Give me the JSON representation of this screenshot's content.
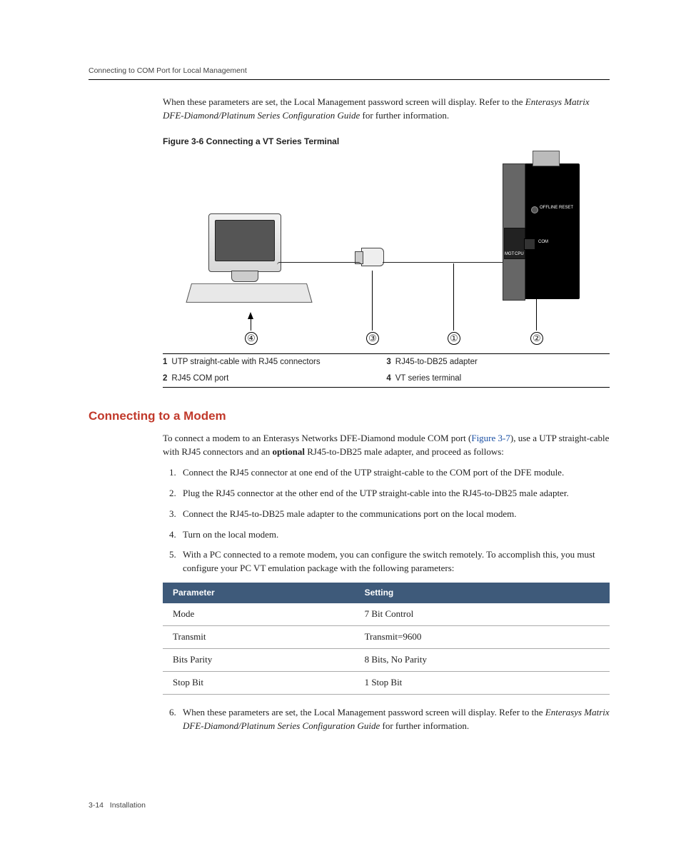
{
  "header": {
    "running": "Connecting to COM Port for Local Management"
  },
  "intro": {
    "line1": "When these parameters are set, the Local Management password screen will display. Refer to the ",
    "italic": "Enterasys Matrix DFE-Diamond/Platinum Series Configuration Guide",
    "line2": " for further information."
  },
  "figure": {
    "caption": "Figure 3-6    Connecting a VT Series Terminal",
    "markers": {
      "m1": "①",
      "m2": "②",
      "m3": "③",
      "m4": "④"
    },
    "module_labels": {
      "reset": "OFFLINE\nRESET",
      "com": "COM",
      "mgmt": "MGT",
      "cpu": "CPU"
    }
  },
  "legend": {
    "rows": [
      {
        "n": "1",
        "text": "UTP straight-cable with RJ45 connectors"
      },
      {
        "n": "2",
        "text": "RJ45 COM port"
      },
      {
        "n": "3",
        "text": "RJ45-to-DB25 adapter"
      },
      {
        "n": "4",
        "text": "VT series terminal"
      }
    ]
  },
  "section": {
    "heading": "Connecting to a Modem",
    "para_pre": "To connect a modem to an Enterasys Networks DFE-Diamond module COM port (",
    "para_link": "Figure 3-7",
    "para_mid": "), use a UTP straight-cable with RJ45 connectors and an ",
    "para_bold": "optional",
    "para_post": " RJ45-to-DB25 male adapter, and proceed as follows:",
    "steps": [
      "Connect the RJ45 connector at one end of the UTP straight-cable to the COM port  of the DFE module.",
      "Plug the RJ45 connector at the other end of the UTP straight-cable into the RJ45-to-DB25 male adapter.",
      "Connect the RJ45-to-DB25 male adapter to the communications port on the local modem.",
      "Turn on the local modem.",
      "With a PC connected to a remote modem, you can configure the switch remotely. To accomplish this, you must configure your PC VT emulation package with the following parameters:"
    ],
    "step6_pre": "When these parameters are set, the Local Management password screen will display. Refer to the ",
    "step6_italic": "Enterasys Matrix DFE-Diamond/Platinum Series Configuration Guide",
    "step6_post": " for further information."
  },
  "param_table": {
    "headers": {
      "param": "Parameter",
      "setting": "Setting"
    },
    "rows": [
      {
        "param": "Mode",
        "setting": "7 Bit Control"
      },
      {
        "param": "Transmit",
        "setting": "Transmit=9600"
      },
      {
        "param": "Bits Parity",
        "setting": "8 Bits, No Parity"
      },
      {
        "param": "Stop Bit",
        "setting": "1 Stop Bit"
      }
    ]
  },
  "footer": {
    "page": "3-14",
    "chapter": "Installation"
  }
}
